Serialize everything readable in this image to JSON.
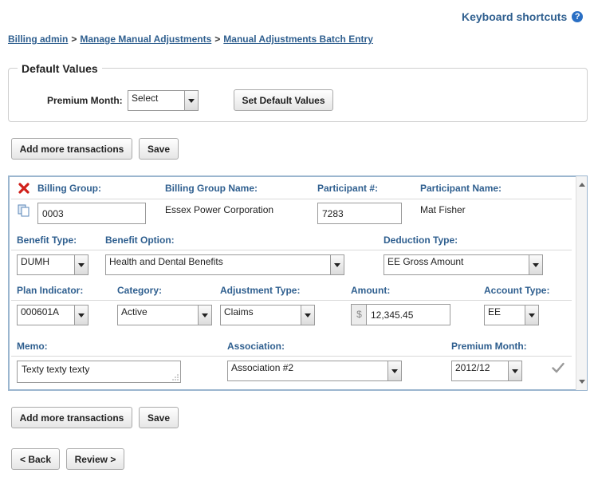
{
  "header": {
    "keyboard_shortcuts": "Keyboard shortcuts",
    "help_glyph": "?"
  },
  "breadcrumb": {
    "items": [
      "Billing admin",
      "Manage Manual Adjustments",
      "Manual Adjustments Batch Entry"
    ],
    "separator": ">"
  },
  "defaults": {
    "legend": "Default Values",
    "premium_month_label": "Premium Month:",
    "premium_month_value": "Select",
    "set_button": "Set Default Values"
  },
  "toolbar": {
    "add_more": "Add more transactions",
    "save": "Save"
  },
  "transaction": {
    "labels": {
      "billing_group": "Billing Group:",
      "billing_group_name": "Billing Group Name:",
      "participant_num": "Participant #:",
      "participant_name": "Participant Name:",
      "benefit_type": "Benefit Type:",
      "benefit_option": "Benefit Option:",
      "deduction_type": "Deduction Type:",
      "plan_indicator": "Plan Indicator:",
      "category": "Category:",
      "adjustment_type": "Adjustment Type:",
      "amount": "Amount:",
      "account_type": "Account Type:",
      "memo": "Memo:",
      "association": "Association:",
      "premium_month": "Premium Month:"
    },
    "values": {
      "billing_group": "0003",
      "billing_group_name": "Essex Power Corporation",
      "participant_num": "7283",
      "participant_name": "Mat Fisher",
      "benefit_type": "DUMH",
      "benefit_option": "Health and Dental Benefits",
      "deduction_type": "EE Gross Amount",
      "plan_indicator": "000601A",
      "category": "Active",
      "adjustment_type": "Claims",
      "currency_symbol": "$",
      "amount": "12,345.45",
      "account_type": "EE",
      "memo": "Texty texty texty",
      "association": "Association #2",
      "premium_month": "2012/12"
    }
  },
  "footer": {
    "add_more": "Add more transactions",
    "save": "Save",
    "back": "< Back",
    "review": "Review >"
  },
  "colors": {
    "link": "#2f5f8f",
    "panel_border": "#9bb6cf",
    "delete_red": "#d0201a",
    "help_blue": "#2a6fc4"
  },
  "icons": [
    "help-icon",
    "delete-icon",
    "copy-icon",
    "dropdown-arrow-icon",
    "resize-grip-icon",
    "check-icon"
  ]
}
